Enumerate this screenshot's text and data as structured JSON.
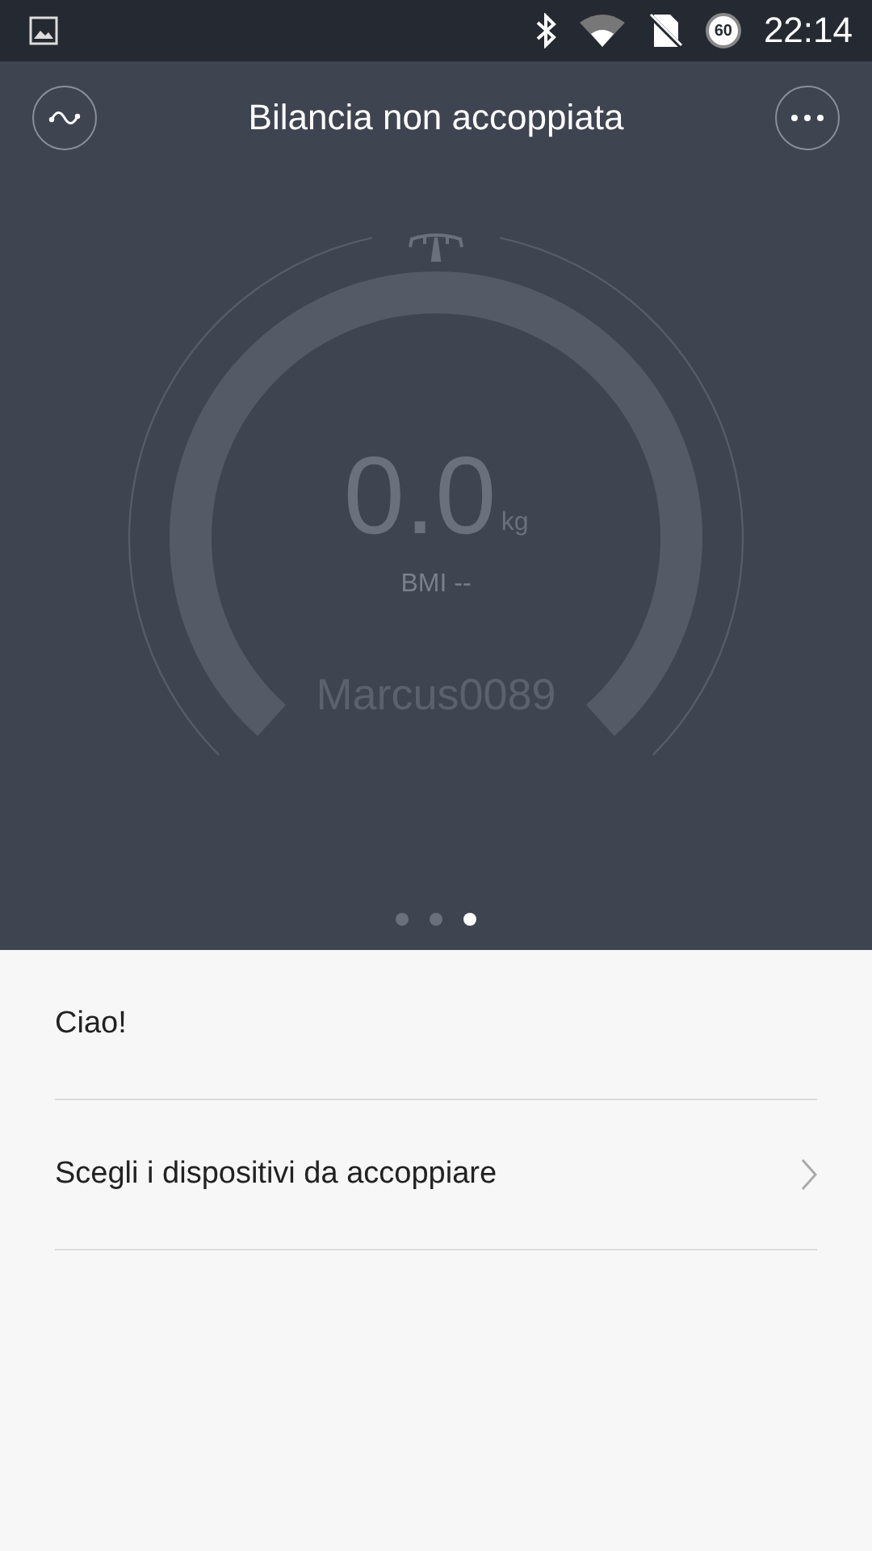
{
  "status_bar": {
    "battery": "60",
    "time": "22:14"
  },
  "header": {
    "title": "Bilancia non accoppiata"
  },
  "gauge": {
    "weight": "0.0",
    "unit": "kg",
    "bmi": "BMI --",
    "user": "Marcus0089"
  },
  "pager": [
    {
      "selected": false
    },
    {
      "selected": false
    },
    {
      "selected": true
    }
  ],
  "list": [
    {
      "kind": "text",
      "label": "Ciao!"
    },
    {
      "kind": "link",
      "label": "Scegli i dispositivi da accoppiare"
    }
  ]
}
